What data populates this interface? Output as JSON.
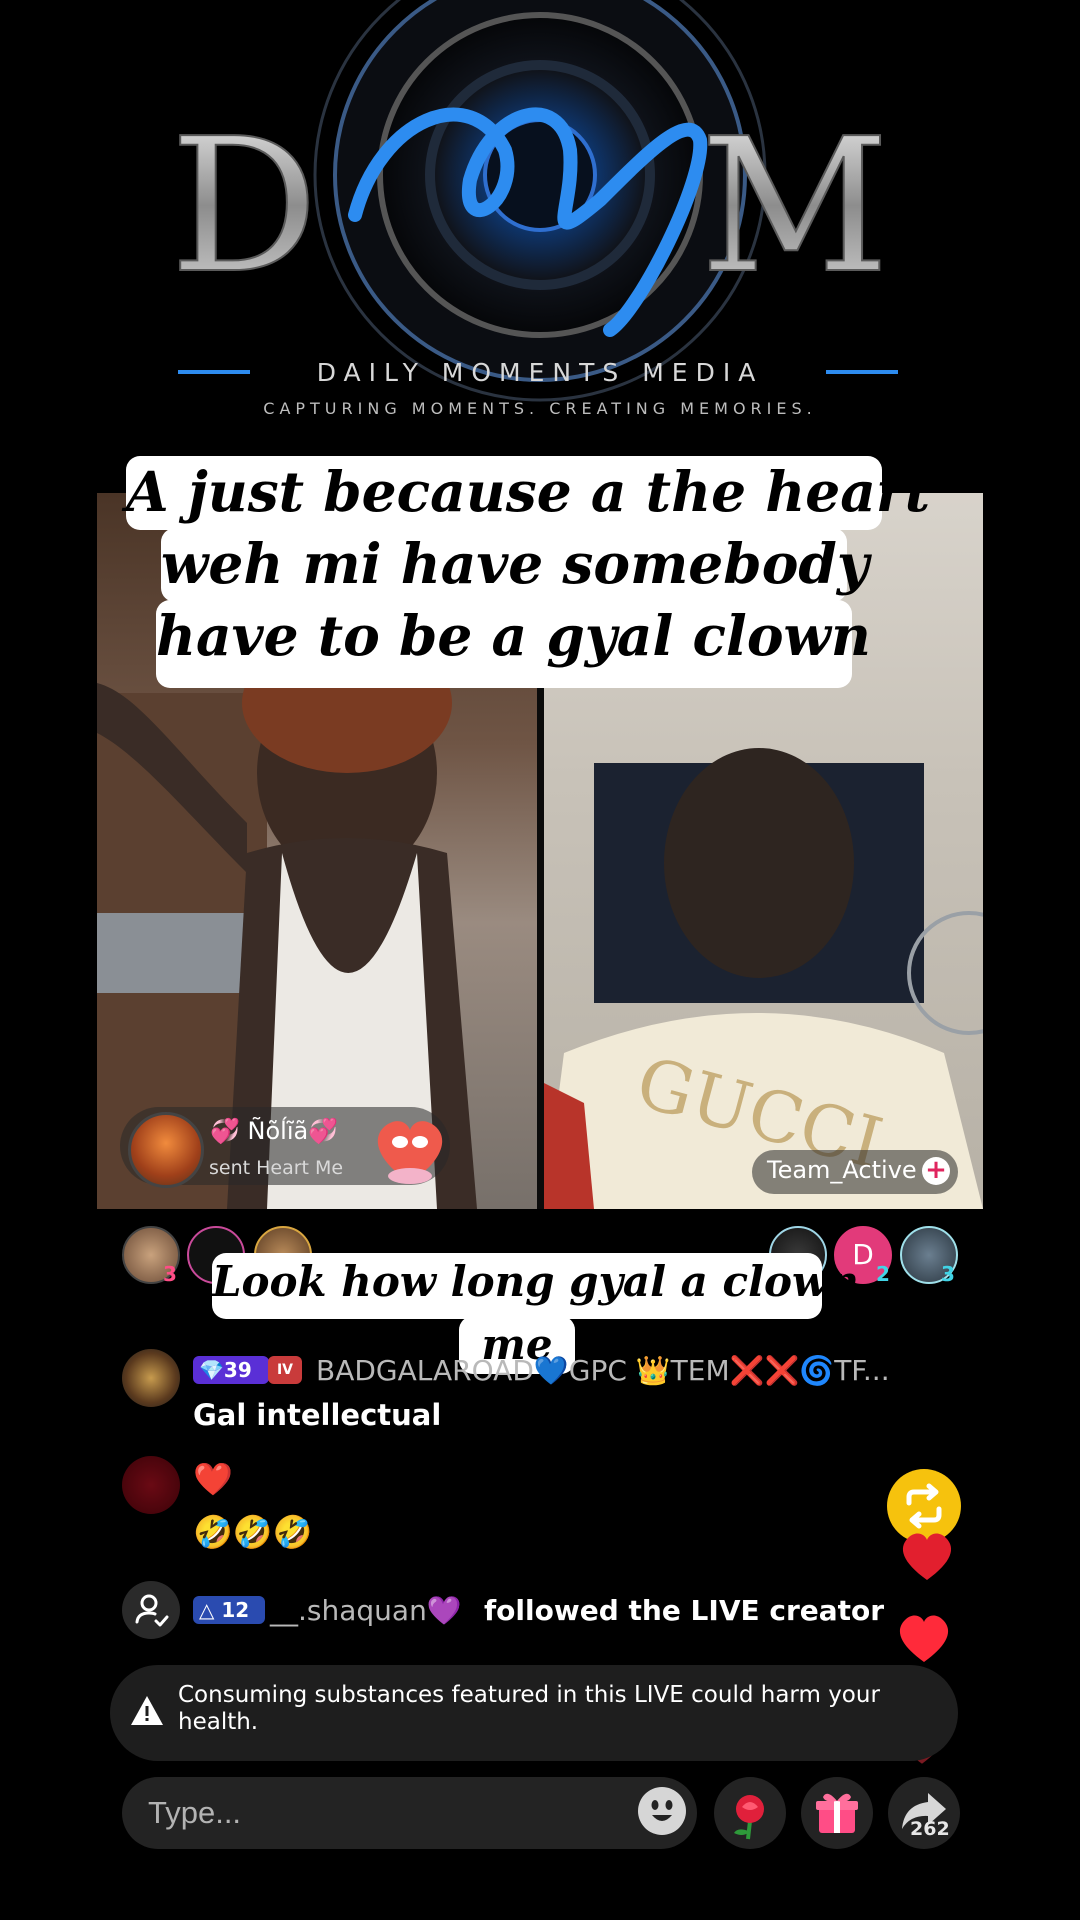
{
  "logo": {
    "tagline": "DAILY MOMENTS MEDIA",
    "subtagline": "CAPTURING MOMENTS. CREATING MEMORIES.",
    "brand_color": "#2d8cf0"
  },
  "caption_top": {
    "lines": [
      "A just because a the heart",
      "weh mi have  somebody",
      "have to be a gyal clown"
    ]
  },
  "gift": {
    "user": "💞 Ñõĺĩã💞",
    "message": "sent Heart Me"
  },
  "team": {
    "label": "Team_Active",
    "plus_icon": "plus-icon"
  },
  "viewers_left": [
    {
      "rank": "3"
    },
    {
      "rank": ""
    },
    {
      "rank": ""
    }
  ],
  "viewers_right": [
    {
      "rank": "",
      "initial": ""
    },
    {
      "rank": "2",
      "initial": "D"
    },
    {
      "rank": "3",
      "initial": ""
    }
  ],
  "caption_bottom": {
    "lines": [
      "Look how long gyal a clown",
      "me"
    ]
  },
  "comments": [
    {
      "badge_level": "39",
      "badge_tag": "IV",
      "username": "BADGALAROAD💙GPC 👑TEM❌❌🌀TF...",
      "text": "Gal intellectual"
    },
    {
      "heart": "❤️",
      "text": "🤣🤣🤣"
    }
  ],
  "follow_event": {
    "level": "12",
    "username": "__.shaquan💜",
    "text": "followed the LIVE creator"
  },
  "warning": {
    "text": "Consuming substances featured in this LIVE could harm your health."
  },
  "input": {
    "placeholder": "Type..."
  },
  "share": {
    "count": "262"
  },
  "colors": {
    "heart": "#ff2a3a",
    "repost": "#f6c20d",
    "bar_bg": "#232323"
  }
}
